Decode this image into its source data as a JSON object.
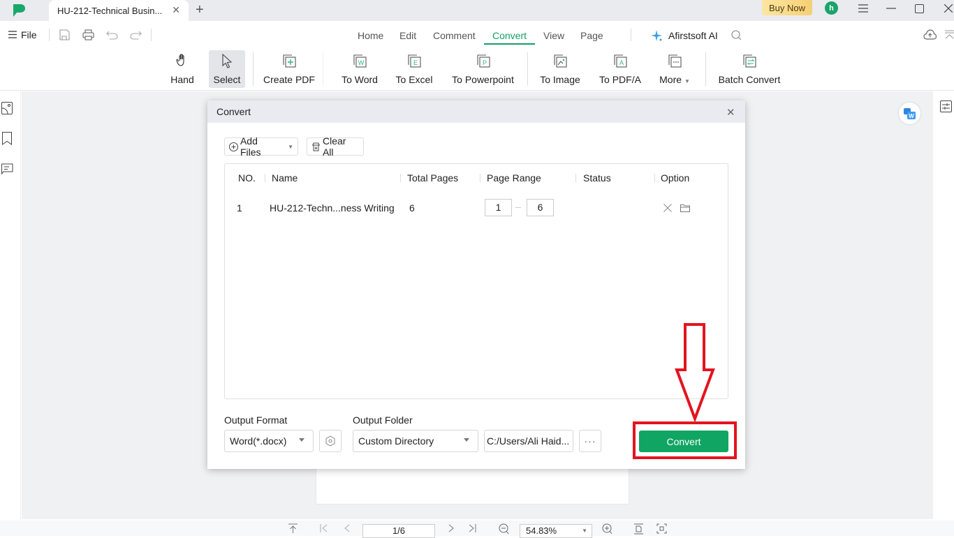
{
  "titlebar": {
    "tab_title": "HU-212-Technical Busin...",
    "buy_now": "Buy Now",
    "avatar_letter": "h"
  },
  "menu": {
    "file": "File",
    "nav_tabs": [
      "Home",
      "Edit",
      "Comment",
      "Convert",
      "View",
      "Page"
    ],
    "active_tab": "Convert",
    "ai_label": "Afirstsoft AI"
  },
  "ribbon": {
    "items": [
      {
        "label": "Hand",
        "icon": "hand-icon"
      },
      {
        "label": "Select",
        "icon": "cursor-icon"
      },
      {
        "label": "Create PDF",
        "icon": "create-pdf-icon"
      },
      {
        "label": "To Word",
        "icon": "word-icon",
        "glyph": "W"
      },
      {
        "label": "To Excel",
        "icon": "excel-icon",
        "glyph": "E"
      },
      {
        "label": "To Powerpoint",
        "icon": "powerpoint-icon",
        "glyph": "P"
      },
      {
        "label": "To Image",
        "icon": "image-icon"
      },
      {
        "label": "To PDF/A",
        "icon": "pdfa-icon",
        "glyph": "A"
      },
      {
        "label": "More",
        "icon": "more-icon"
      },
      {
        "label": "Batch Convert",
        "icon": "batch-convert-icon"
      }
    ]
  },
  "dialog": {
    "title": "Convert",
    "add_files": "Add Files",
    "clear_all": "Clear All",
    "columns": [
      "NO.",
      "Name",
      "Total Pages",
      "Page Range",
      "Status",
      "Option"
    ],
    "rows": [
      {
        "no": "1",
        "name": "HU-212-Techn...ness Writing",
        "total_pages": "6",
        "range_from": "1",
        "range_to": "6",
        "status": ""
      }
    ],
    "output_format_label": "Output Format",
    "output_format_value": "Word(*.docx)",
    "output_folder_label": "Output Folder",
    "output_folder_value": "Custom Directory",
    "output_path": "C:/Users/Ali Haid...",
    "browse": "···",
    "convert_button": "Convert"
  },
  "statusbar": {
    "page_indicator": "1/6",
    "zoom_level": "54.83%"
  },
  "colors": {
    "accent": "#14a063",
    "convert_button": "#11a563",
    "annotation_red": "#e3141f"
  }
}
